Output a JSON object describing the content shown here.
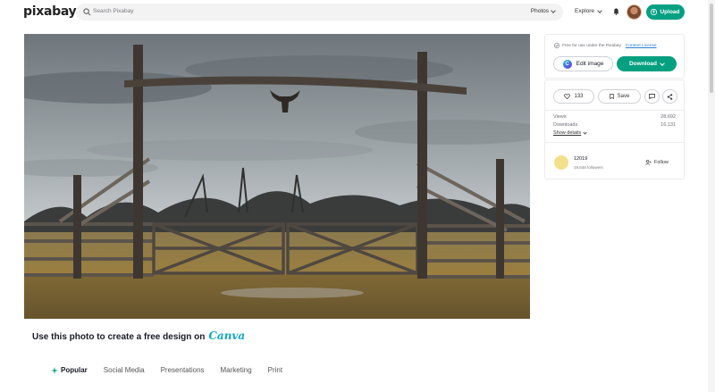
{
  "header": {
    "logo": "pixabay",
    "search_placeholder": "Search Pixabay",
    "media_type": "Photos",
    "explore": "Explore",
    "upload_label": "Upload",
    "bell_icon": "bell-icon",
    "accent": "#05a081"
  },
  "image": {
    "description_icon": "photo"
  },
  "panel": {
    "license_text": "Free for use under the Pixabay",
    "license_link": "Content License",
    "edit_label": "Edit image",
    "download_label": "Download",
    "likes": "133",
    "save_label": "Save",
    "views_label": "Views",
    "views_value": "28,692",
    "downloads_label": "Downloads",
    "downloads_value": "16,131",
    "show_details": "Show details",
    "user_name": "12019",
    "followers": "19,648 followers",
    "follow_label": "Follow"
  },
  "promo": {
    "text": "Use this photo to create a free design on",
    "brand": "Canva"
  },
  "tabs": [
    {
      "label": "Popular"
    },
    {
      "label": "Social Media"
    },
    {
      "label": "Presentations"
    },
    {
      "label": "Marketing"
    },
    {
      "label": "Print"
    }
  ]
}
